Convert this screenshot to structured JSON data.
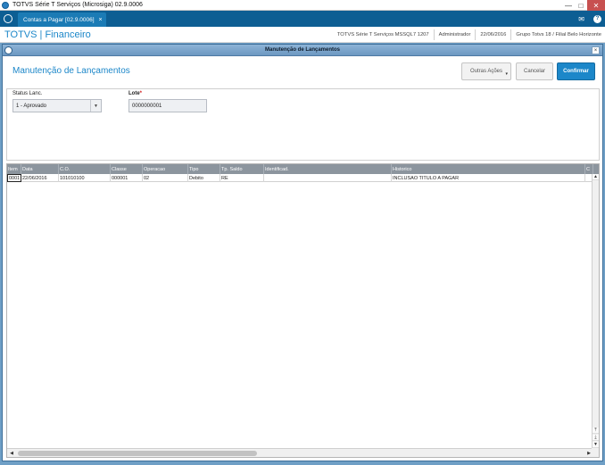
{
  "window": {
    "title": "TOTVS Série T Serviços (Microsiga) 02.9.0006",
    "minimize": "—",
    "maximize": "□",
    "close": "✕"
  },
  "tabs": [
    {
      "label": "Contas a Pagar [02.9.0006]",
      "close": "×"
    }
  ],
  "topbar": {
    "mail_icon": "mail-icon",
    "help_label": "?"
  },
  "header": {
    "brand": "TOTVS | Financeiro",
    "environment": "TOTVS Série T Serviços MSSQL7 1207",
    "user": "Administrador",
    "date": "22/06/2016",
    "company": "Grupo Totvs 18 / Filial Belo Horizonte"
  },
  "dialog": {
    "window_title": "Manutenção de Lançamentos",
    "close": "×",
    "page_title": "Manutenção de Lançamentos",
    "buttons": {
      "other_actions": "Outras Ações",
      "other_actions_caret": "▾",
      "cancel": "Cancelar",
      "confirm": "Confirmar"
    }
  },
  "form": {
    "status_label": "Status Lanc.",
    "status_value": "1 - Aprovado",
    "status_arrow": "▼",
    "lote_label": "Lote",
    "lote_required": "*",
    "lote_value": "0000000001"
  },
  "grid": {
    "columns": [
      "Item",
      "Data",
      "C.O.",
      "Classe",
      "Operacao",
      "Tipo",
      "Tp. Saldo",
      "Identificad.",
      "Historico",
      "C"
    ],
    "rows": [
      [
        "0001",
        "22/06/2016",
        "101010100",
        "000001",
        "02",
        "Debito",
        "RE",
        "",
        "INCLUSAO TITULO A PAGAR",
        ""
      ]
    ],
    "scroll": {
      "up": "▲",
      "down": "▼",
      "top": "⤒",
      "bottom": "⤓",
      "left": "◀",
      "right": "▶"
    }
  },
  "colors": {
    "brand": "#1c87c9",
    "tabbar": "#0d5e93",
    "confirm": "#1c87c9",
    "grid_header": "#8c959e"
  }
}
